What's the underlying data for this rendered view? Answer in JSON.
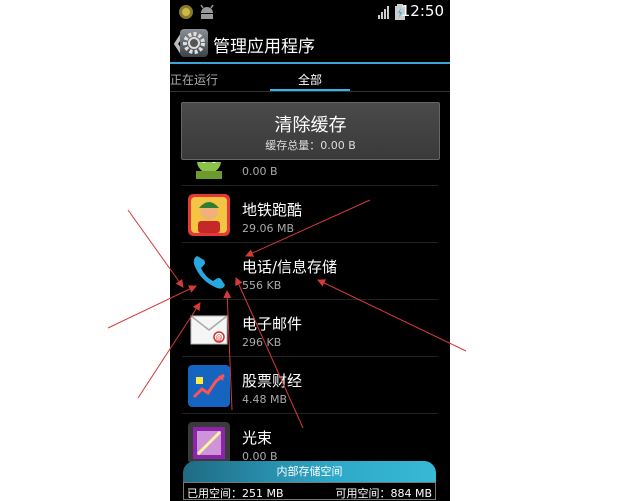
{
  "status_bar": {
    "time": "12:50",
    "icons": [
      "notification-app-icon",
      "android-debug-icon",
      "signal-icon",
      "battery-icon"
    ]
  },
  "header": {
    "back_glyph": "❮",
    "icon": "settings-gear-icon",
    "title": "管理应用程序"
  },
  "tabs": [
    {
      "label": "正在运行",
      "selected": false
    },
    {
      "label": "全部",
      "selected": true
    }
  ],
  "cache": {
    "button_label": "清除缓存",
    "total_label": "缓存总量：0.00 B"
  },
  "apps": [
    {
      "name": "",
      "size": "0.00 B",
      "icon": "android-app-icon"
    },
    {
      "name": "地铁跑酷",
      "size": "29.06 MB",
      "icon": "subway-surfers-icon"
    },
    {
      "name": "电话/信息存储",
      "size": "556 KB",
      "icon": "phone-icon"
    },
    {
      "name": "电子邮件",
      "size": "296 KB",
      "icon": "email-icon"
    },
    {
      "name": "股票财经",
      "size": "4.48 MB",
      "icon": "stocks-icon"
    },
    {
      "name": "光束",
      "size": "0.00 B",
      "icon": "beam-icon"
    }
  ],
  "storage": {
    "title": "内部存储空间",
    "used_label": "已用空间：251 MB",
    "free_label": "可用空间：884 MB"
  },
  "colors": {
    "accent": "#33b5e5",
    "annotation_arrow": "#d43a3a",
    "background": "#000000"
  }
}
